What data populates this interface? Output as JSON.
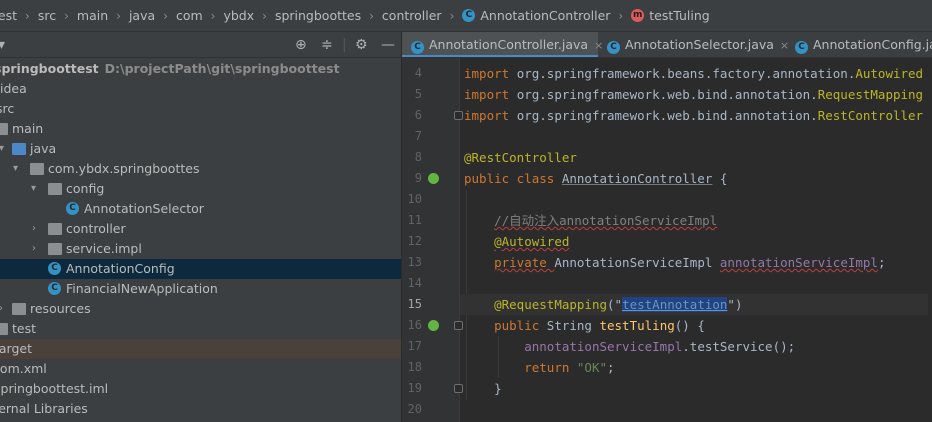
{
  "breadcrumb": {
    "items": [
      "test",
      "src",
      "main",
      "java",
      "com",
      "ybdx",
      "springboottes",
      "controller",
      "AnnotationController",
      "testTuling"
    ]
  },
  "project": {
    "toolbar": {
      "dropdown_icon": "chevron-down-icon",
      "locate_icon": "crosshair-icon",
      "collapse_icon": "collapse-icon",
      "settings_icon": "gear-icon",
      "hide_icon": "minimize-icon"
    },
    "tree": [
      {
        "label": "springboottest",
        "hint": "D:\\projectPath\\git\\springboottest"
      },
      {
        "label": ".idea"
      },
      {
        "label": "src"
      },
      {
        "label": "main"
      },
      {
        "label": "java"
      },
      {
        "label": "com.ybdx.springboottes"
      },
      {
        "label": "config"
      },
      {
        "label": "AnnotationSelector"
      },
      {
        "label": "controller"
      },
      {
        "label": "service.impl"
      },
      {
        "label": "AnnotationConfig"
      },
      {
        "label": "FinancialNewApplication"
      },
      {
        "label": "resources"
      },
      {
        "label": "test"
      },
      {
        "label": "target"
      },
      {
        "label": "pom.xml"
      },
      {
        "label": "springboottest.iml"
      },
      {
        "label": "External Libraries"
      }
    ]
  },
  "tabs": [
    {
      "label": "AnnotationController.java",
      "close": "×"
    },
    {
      "label": "AnnotationSelector.java",
      "close": "×"
    },
    {
      "label": "AnnotationConfig.java"
    }
  ],
  "editor": {
    "line_numbers": [
      "4",
      "5",
      "6",
      "7",
      "8",
      "9",
      "10",
      "11",
      "12",
      "13",
      "14",
      "15",
      "16",
      "17",
      "18",
      "19",
      "20"
    ],
    "lines": {
      "l4_kw": "import ",
      "l4_rest": "org.springframework.beans.factory.annotation.",
      "l4_cls": "Autowired",
      "l5_kw": "import ",
      "l5_rest": "org.springframework.web.bind.annotation.",
      "l5_cls": "RequestMapping",
      "l6_kw": "import ",
      "l6_rest": "org.springframework.web.bind.annotation.",
      "l6_cls": "RestController",
      "l8": "@RestController",
      "l9_kw": "public class ",
      "l9_name": "AnnotationController",
      "l9_end": " {",
      "l11": "//自动注入annotationServiceImpl",
      "l12": "@Autowired",
      "l13_kw": "private ",
      "l13_type": "AnnotationServiceImpl ",
      "l13_field": "annotationServiceImpl",
      "l13_end": ";",
      "l15_ann": "@RequestMapping",
      "l15_open": "(\"",
      "l15_sel": "testAnnotation",
      "l15_close": "\")",
      "l16_kw": "public ",
      "l16_type": "String ",
      "l16_name": "testTuling",
      "l16_end": "() {",
      "l17_field": "annotationServiceImpl",
      "l17_rest": ".testService();",
      "l18_kw": "return ",
      "l18_str": "\"OK\"",
      "l18_end": ";",
      "l19": "}"
    }
  }
}
